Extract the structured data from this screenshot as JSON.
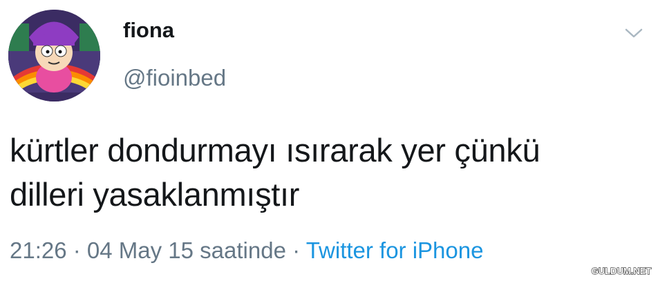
{
  "user": {
    "display_name": "fiona",
    "handle": "@fioinbed"
  },
  "icons": {
    "caret": "chevron-down-icon",
    "avatar": "cartoon-avatar"
  },
  "tweet": {
    "text_line1": "kürtler dondurmayı ısırarak yer çünkü",
    "text_line2": "dilleri yasaklanmıştır"
  },
  "meta": {
    "time": "21:26",
    "sep1": " · ",
    "date_label": "04 May 15 saatinde",
    "sep2": " · ",
    "source": "Twitter for iPhone"
  },
  "watermark": {
    "text": "GULDUM.NET"
  },
  "colors": {
    "text": "#14171a",
    "secondary": "#657786",
    "link": "#1b95e0"
  }
}
